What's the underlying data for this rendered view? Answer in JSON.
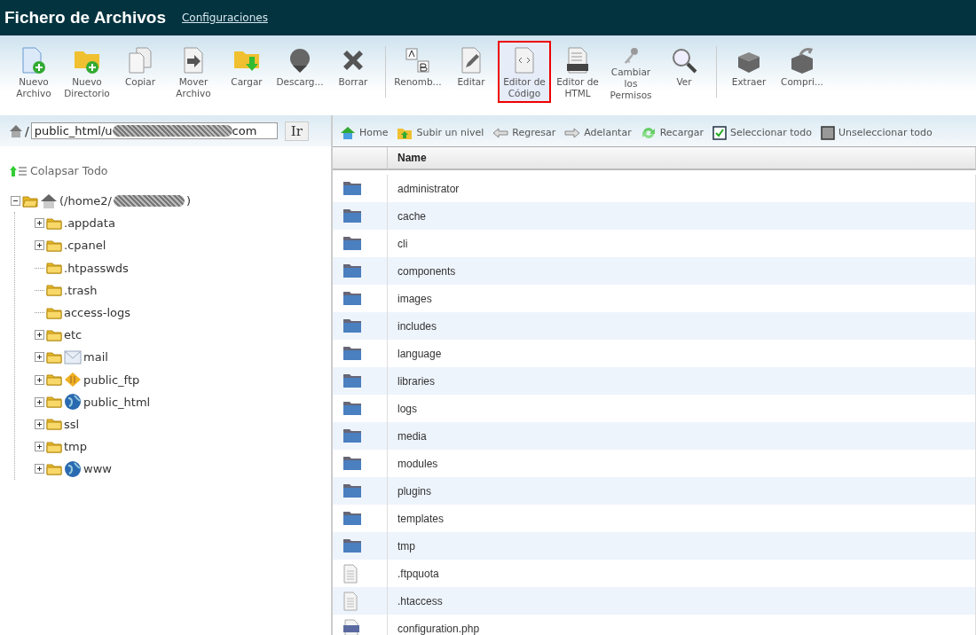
{
  "header": {
    "title": "Fichero de Archivos",
    "link": "Configuraciones"
  },
  "toolbar": [
    [
      {
        "kind": "new-file",
        "label": "Nuevo Archivo",
        "selected": false
      },
      {
        "kind": "new-folder",
        "label": "Nuevo Directorio",
        "selected": false
      },
      {
        "kind": "copy",
        "label": "Copiar",
        "selected": false
      },
      {
        "kind": "move",
        "label": "Mover Archivo",
        "selected": false
      },
      {
        "kind": "upload",
        "label": "Cargar",
        "selected": false
      },
      {
        "kind": "download",
        "label": "Descarg...",
        "selected": false
      },
      {
        "kind": "delete",
        "label": "Borrar",
        "selected": false
      }
    ],
    [
      {
        "kind": "rename",
        "label": "Renomb...",
        "selected": false
      },
      {
        "kind": "edit",
        "label": "Editar",
        "selected": false
      },
      {
        "kind": "code",
        "label": "Editor de Código",
        "selected": true
      },
      {
        "kind": "html",
        "label": "Editor de HTML",
        "selected": false
      },
      {
        "kind": "key",
        "label": "Cambiar los Permisos",
        "selected": false
      },
      {
        "kind": "search",
        "label": "Ver",
        "selected": false
      }
    ],
    [
      {
        "kind": "extract",
        "label": "Extraer",
        "selected": false
      },
      {
        "kind": "compress",
        "label": "Compri...",
        "selected": false
      }
    ]
  ],
  "path": {
    "separator": "/",
    "value_start": "public_html/u",
    "value_end": "com",
    "go": "Ir"
  },
  "collapse_all": "Colapsar Todo",
  "tree": {
    "label_start": "(/home2/",
    "label_end": ")",
    "expanded": true,
    "children": [
      {
        "name": ".appdata",
        "expandable": true,
        "kind": "folder"
      },
      {
        "name": ".cpanel",
        "expandable": true,
        "kind": "folder"
      },
      {
        "name": ".htpasswds",
        "expandable": false,
        "kind": "folder"
      },
      {
        "name": ".trash",
        "expandable": false,
        "kind": "folder"
      },
      {
        "name": "access-logs",
        "expandable": false,
        "kind": "folder"
      },
      {
        "name": "etc",
        "expandable": true,
        "kind": "folder"
      },
      {
        "name": "mail",
        "expandable": true,
        "kind": "mail"
      },
      {
        "name": "public_ftp",
        "expandable": true,
        "kind": "ftp"
      },
      {
        "name": "public_html",
        "expandable": true,
        "kind": "web"
      },
      {
        "name": "ssl",
        "expandable": true,
        "kind": "folder"
      },
      {
        "name": "tmp",
        "expandable": true,
        "kind": "folder"
      },
      {
        "name": "www",
        "expandable": true,
        "kind": "web"
      }
    ]
  },
  "nav": [
    {
      "kind": "home",
      "label": "Home"
    },
    {
      "kind": "up",
      "label": "Subir un nivel"
    },
    {
      "kind": "back",
      "label": "Regresar"
    },
    {
      "kind": "forward",
      "label": "Adelantar"
    },
    {
      "kind": "reload",
      "label": "Recargar"
    },
    {
      "kind": "select-all",
      "label": "Seleccionar todo"
    },
    {
      "kind": "unselect-all",
      "label": "Unseleccionar todo"
    }
  ],
  "table": {
    "columns": [
      "Name"
    ],
    "rows": [
      {
        "kind": "folder",
        "name": "administrator"
      },
      {
        "kind": "folder",
        "name": "cache"
      },
      {
        "kind": "folder",
        "name": "cli"
      },
      {
        "kind": "folder",
        "name": "components"
      },
      {
        "kind": "folder",
        "name": "images"
      },
      {
        "kind": "folder",
        "name": "includes"
      },
      {
        "kind": "folder",
        "name": "language"
      },
      {
        "kind": "folder",
        "name": "libraries"
      },
      {
        "kind": "folder",
        "name": "logs"
      },
      {
        "kind": "folder",
        "name": "media"
      },
      {
        "kind": "folder",
        "name": "modules"
      },
      {
        "kind": "folder",
        "name": "plugins"
      },
      {
        "kind": "folder",
        "name": "templates"
      },
      {
        "kind": "folder",
        "name": "tmp"
      },
      {
        "kind": "file",
        "name": ".ftpquota"
      },
      {
        "kind": "file",
        "name": ".htaccess"
      },
      {
        "kind": "php",
        "name": "configuration.php"
      }
    ]
  }
}
